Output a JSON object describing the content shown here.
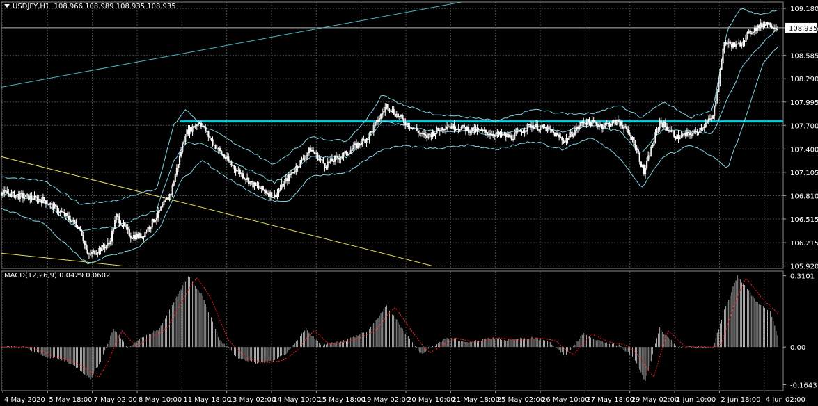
{
  "header": {
    "symbol": "USDJPY,H1",
    "ohlc": "108.966 108.989 108.935 108.935"
  },
  "macd_header": {
    "label": "MACD(12,26,9)",
    "values": "0.0429 0.0602"
  },
  "colors": {
    "background": "#000000",
    "grid": "#4a4a4a",
    "candle": "#ffffff",
    "bands": "#7fd3e6",
    "resistance": "#00d8e8",
    "channel": "#48b8c8",
    "trendline": "#e6e05a",
    "macd_hist": "#c0c0c0",
    "macd_signal": "#ff2020",
    "price_tag_bg": "#ffffff",
    "price_tag_fg": "#000000"
  },
  "chart_data": [
    {
      "type": "line",
      "title": "USDJPY,H1",
      "y_ticks": [
        "109.180",
        "108.935",
        "108.585",
        "108.290",
        "107.995",
        "107.700",
        "107.400",
        "107.105",
        "106.810",
        "106.515",
        "106.215",
        "105.920"
      ],
      "ylim": [
        105.89,
        109.26
      ],
      "current_price": "108.935",
      "current_value": 108.935,
      "resistance_level": 107.75,
      "x_ticks": [
        "4 May 2020",
        "5 May 18:00",
        "7 May 02:00",
        "8 May 10:00",
        "11 May 18:00",
        "13 May 02:00",
        "14 May 10:00",
        "15 May 18:00",
        "19 May 02:00",
        "20 May 10:00",
        "21 May 18:00",
        "25 May 02:00",
        "26 May 10:00",
        "27 May 18:00",
        "29 May 02:00",
        "1 Jun 10:00",
        "2 Jun 18:00",
        "4 Jun 02:00"
      ],
      "x_index_range": [
        0,
        540
      ],
      "series_close": {
        "keypoints": [
          [
            0,
            106.85
          ],
          [
            15,
            106.8
          ],
          [
            30,
            106.75
          ],
          [
            45,
            106.55
          ],
          [
            55,
            106.4
          ],
          [
            60,
            106.05
          ],
          [
            75,
            106.2
          ],
          [
            80,
            106.55
          ],
          [
            90,
            106.3
          ],
          [
            98,
            106.3
          ],
          [
            108,
            106.55
          ],
          [
            118,
            106.85
          ],
          [
            128,
            107.6
          ],
          [
            138,
            107.75
          ],
          [
            148,
            107.45
          ],
          [
            160,
            107.2
          ],
          [
            175,
            106.95
          ],
          [
            190,
            106.8
          ],
          [
            200,
            107.05
          ],
          [
            215,
            107.4
          ],
          [
            225,
            107.2
          ],
          [
            240,
            107.35
          ],
          [
            255,
            107.55
          ],
          [
            268,
            107.95
          ],
          [
            280,
            107.75
          ],
          [
            295,
            107.55
          ],
          [
            310,
            107.7
          ],
          [
            325,
            107.65
          ],
          [
            340,
            107.6
          ],
          [
            355,
            107.55
          ],
          [
            368,
            107.7
          ],
          [
            380,
            107.65
          ],
          [
            392,
            107.5
          ],
          [
            405,
            107.75
          ],
          [
            418,
            107.7
          ],
          [
            430,
            107.75
          ],
          [
            440,
            107.5
          ],
          [
            447,
            107.1
          ],
          [
            458,
            107.75
          ],
          [
            470,
            107.55
          ],
          [
            482,
            107.6
          ],
          [
            495,
            107.8
          ],
          [
            503,
            108.75
          ],
          [
            512,
            108.7
          ],
          [
            522,
            108.9
          ],
          [
            532,
            109.0
          ],
          [
            540,
            108.935
          ]
        ]
      },
      "series_upper_band": {
        "keypoints": [
          [
            0,
            107.05
          ],
          [
            30,
            107.0
          ],
          [
            55,
            106.7
          ],
          [
            80,
            106.75
          ],
          [
            108,
            106.9
          ],
          [
            120,
            107.7
          ],
          [
            128,
            107.9
          ],
          [
            140,
            107.7
          ],
          [
            160,
            107.5
          ],
          [
            190,
            107.2
          ],
          [
            215,
            107.55
          ],
          [
            240,
            107.5
          ],
          [
            255,
            107.8
          ],
          [
            265,
            108.1
          ],
          [
            280,
            107.95
          ],
          [
            300,
            107.85
          ],
          [
            325,
            107.8
          ],
          [
            345,
            107.75
          ],
          [
            370,
            107.9
          ],
          [
            390,
            107.85
          ],
          [
            410,
            107.85
          ],
          [
            430,
            107.95
          ],
          [
            445,
            107.8
          ],
          [
            460,
            108.0
          ],
          [
            480,
            107.8
          ],
          [
            495,
            107.9
          ],
          [
            505,
            108.9
          ],
          [
            515,
            109.2
          ],
          [
            525,
            109.1
          ],
          [
            540,
            109.15
          ]
        ]
      },
      "series_lower_band": {
        "keypoints": [
          [
            0,
            106.65
          ],
          [
            30,
            106.45
          ],
          [
            50,
            106.1
          ],
          [
            60,
            105.95
          ],
          [
            75,
            106.05
          ],
          [
            95,
            106.15
          ],
          [
            110,
            106.4
          ],
          [
            125,
            107.0
          ],
          [
            140,
            107.25
          ],
          [
            160,
            107.0
          ],
          [
            185,
            106.75
          ],
          [
            200,
            106.75
          ],
          [
            215,
            107.05
          ],
          [
            240,
            107.1
          ],
          [
            265,
            107.4
          ],
          [
            280,
            107.45
          ],
          [
            300,
            107.4
          ],
          [
            325,
            107.45
          ],
          [
            345,
            107.4
          ],
          [
            370,
            107.5
          ],
          [
            390,
            107.4
          ],
          [
            410,
            107.55
          ],
          [
            430,
            107.3
          ],
          [
            445,
            106.9
          ],
          [
            460,
            107.3
          ],
          [
            480,
            107.45
          ],
          [
            495,
            107.3
          ],
          [
            505,
            107.15
          ],
          [
            515,
            107.65
          ],
          [
            530,
            108.5
          ],
          [
            540,
            108.7
          ]
        ]
      },
      "trendline_upper": [
        [
          -10,
          107.35
        ],
        [
          300,
          105.92
        ]
      ],
      "trendline_lower": [
        [
          -10,
          106.1
        ],
        [
          85,
          105.92
        ]
      ],
      "channel_line": [
        [
          -10,
          108.15
        ],
        [
          320,
          109.26
        ]
      ]
    },
    {
      "type": "bar",
      "title": "MACD(12,26,9)",
      "y_ticks": [
        "0.3101",
        "0.00",
        "-0.1643"
      ],
      "ylim": [
        -0.19,
        0.33
      ],
      "x_index_range": [
        0,
        540
      ],
      "macd_keypoints": [
        [
          0,
          0.0
        ],
        [
          15,
          0.0
        ],
        [
          30,
          -0.04
        ],
        [
          45,
          -0.06
        ],
        [
          55,
          -0.1
        ],
        [
          62,
          -0.14
        ],
        [
          70,
          -0.05
        ],
        [
          78,
          0.08
        ],
        [
          88,
          0.0
        ],
        [
          98,
          0.04
        ],
        [
          110,
          0.08
        ],
        [
          122,
          0.22
        ],
        [
          130,
          0.31
        ],
        [
          140,
          0.22
        ],
        [
          152,
          0.03
        ],
        [
          165,
          -0.05
        ],
        [
          178,
          -0.07
        ],
        [
          190,
          -0.06
        ],
        [
          200,
          -0.02
        ],
        [
          212,
          0.08
        ],
        [
          222,
          0.01
        ],
        [
          240,
          0.03
        ],
        [
          255,
          0.07
        ],
        [
          268,
          0.18
        ],
        [
          280,
          0.07
        ],
        [
          292,
          -0.03
        ],
        [
          310,
          0.04
        ],
        [
          325,
          0.02
        ],
        [
          340,
          0.04
        ],
        [
          355,
          0.03
        ],
        [
          368,
          0.04
        ],
        [
          380,
          0.03
        ],
        [
          392,
          -0.04
        ],
        [
          405,
          0.06
        ],
        [
          418,
          0.02
        ],
        [
          430,
          0.01
        ],
        [
          440,
          -0.05
        ],
        [
          448,
          -0.15
        ],
        [
          458,
          0.08
        ],
        [
          470,
          0.0
        ],
        [
          482,
          0.0
        ],
        [
          495,
          0.0
        ],
        [
          503,
          0.16
        ],
        [
          512,
          0.31
        ],
        [
          525,
          0.2
        ],
        [
          535,
          0.15
        ],
        [
          540,
          0.05
        ]
      ]
    }
  ]
}
